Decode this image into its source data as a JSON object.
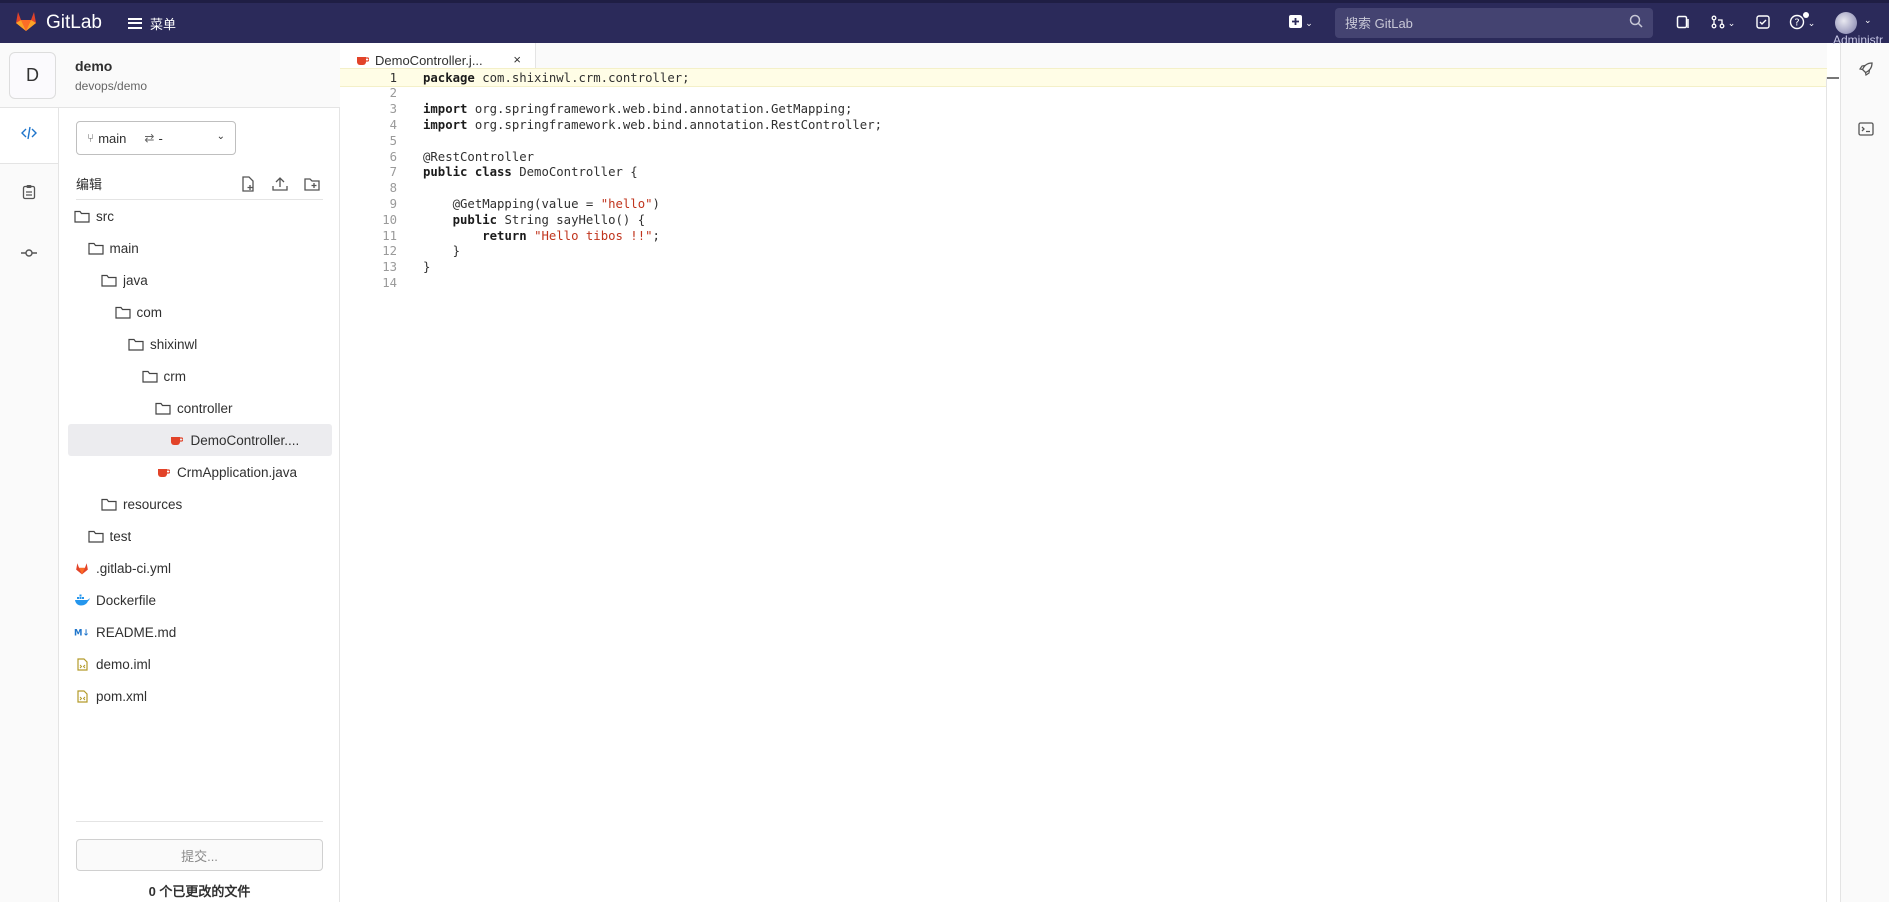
{
  "navbar": {
    "logo_text": "GitLab",
    "menu_label": "菜单",
    "search_placeholder": "搜索 GitLab",
    "user_label": "Administr"
  },
  "project": {
    "avatar_letter": "D",
    "name": "demo",
    "path": "devops/demo"
  },
  "rail": {
    "items": [
      "code-icon",
      "clipboard-icon",
      "commit-icon"
    ]
  },
  "branch": {
    "name": "main",
    "mr": "-"
  },
  "edit": {
    "label": "编辑"
  },
  "tree": [
    {
      "label": "src",
      "type": "folder",
      "depth": 0
    },
    {
      "label": "main",
      "type": "folder",
      "depth": 1
    },
    {
      "label": "java",
      "type": "folder",
      "depth": 2
    },
    {
      "label": "com",
      "type": "folder",
      "depth": 3
    },
    {
      "label": "shixinwl",
      "type": "folder",
      "depth": 4
    },
    {
      "label": "crm",
      "type": "folder",
      "depth": 5
    },
    {
      "label": "controller",
      "type": "folder",
      "depth": 6
    },
    {
      "label": "DemoController....",
      "type": "java",
      "depth": 7,
      "selected": true
    },
    {
      "label": "CrmApplication.java",
      "type": "java",
      "depth": 6
    },
    {
      "label": "resources",
      "type": "folder",
      "depth": 2
    },
    {
      "label": "test",
      "type": "folder",
      "depth": 1
    },
    {
      "label": ".gitlab-ci.yml",
      "type": "gitlab",
      "depth": 0
    },
    {
      "label": "Dockerfile",
      "type": "docker",
      "depth": 0
    },
    {
      "label": "README.md",
      "type": "markdown",
      "depth": 0
    },
    {
      "label": "demo.iml",
      "type": "xml",
      "depth": 0
    },
    {
      "label": "pom.xml",
      "type": "xml",
      "depth": 0
    }
  ],
  "commit": {
    "button_label": "提交...",
    "changed_files": "0 个已更改的文件"
  },
  "tab": {
    "label": "DemoController.j...",
    "close": "×"
  },
  "code_lines": [
    {
      "n": "1",
      "current": true,
      "parts": [
        [
          "kw",
          "package"
        ],
        [
          "t",
          " com.shixinwl.crm.controller;"
        ]
      ]
    },
    {
      "n": "2",
      "parts": []
    },
    {
      "n": "3",
      "parts": [
        [
          "kw",
          "import"
        ],
        [
          "t",
          " org.springframework.web.bind.annotation.GetMapping;"
        ]
      ]
    },
    {
      "n": "4",
      "parts": [
        [
          "kw",
          "import"
        ],
        [
          "t",
          " org.springframework.web.bind.annotation.RestController;"
        ]
      ]
    },
    {
      "n": "5",
      "parts": []
    },
    {
      "n": "6",
      "parts": [
        [
          "t",
          "@RestController"
        ]
      ]
    },
    {
      "n": "7",
      "parts": [
        [
          "kw",
          "public class"
        ],
        [
          "t",
          " DemoController {"
        ]
      ]
    },
    {
      "n": "8",
      "parts": []
    },
    {
      "n": "9",
      "parts": [
        [
          "t",
          "    @GetMapping(value = "
        ],
        [
          "str",
          "\"hello\""
        ],
        [
          "t",
          ")"
        ]
      ]
    },
    {
      "n": "10",
      "parts": [
        [
          "t",
          "    "
        ],
        [
          "kw",
          "public"
        ],
        [
          "t",
          " String sayHello() {"
        ]
      ]
    },
    {
      "n": "11",
      "parts": [
        [
          "t",
          "        "
        ],
        [
          "kw",
          "return"
        ],
        [
          "t",
          " "
        ],
        [
          "str",
          "\"Hello tibos !!\""
        ],
        [
          "t",
          ";"
        ]
      ]
    },
    {
      "n": "12",
      "parts": [
        [
          "t",
          "    }"
        ]
      ]
    },
    {
      "n": "13",
      "parts": [
        [
          "t",
          "}"
        ]
      ]
    },
    {
      "n": "14",
      "parts": []
    }
  ],
  "right_rail": {
    "items": [
      "rocket-icon",
      "terminal-icon"
    ]
  }
}
